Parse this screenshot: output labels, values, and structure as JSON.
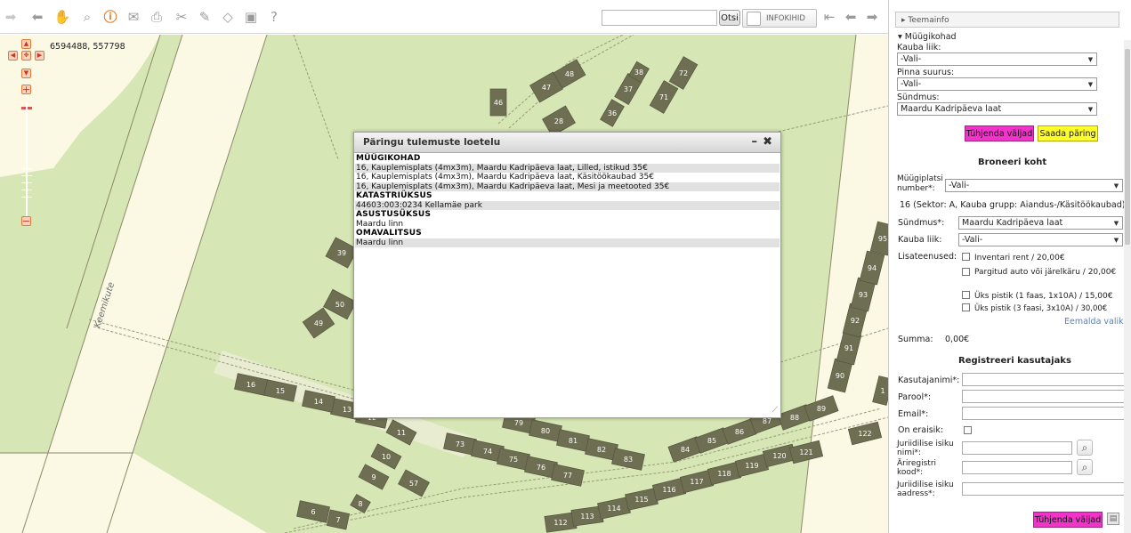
{
  "toolbar": {
    "help_label": "?",
    "search": {
      "value": "",
      "placeholder": ""
    },
    "search_button_label": "Otsi",
    "infokihid_label": "INFOKIHID"
  },
  "map": {
    "coordinates": "6594488, 557798",
    "street_label": "Keemikute",
    "parcels": [
      "6",
      "7",
      "8",
      "9",
      "10",
      "11",
      "12",
      "13",
      "14",
      "15",
      "16",
      "39",
      "46",
      "47",
      "48",
      "49",
      "50",
      "57",
      "72",
      "71",
      "37",
      "38",
      "36",
      "28",
      "73",
      "74",
      "75",
      "76",
      "77",
      "79",
      "80",
      "81",
      "82",
      "83",
      "84",
      "85",
      "86",
      "87",
      "88",
      "89",
      "90",
      "91",
      "92",
      "93",
      "94",
      "95",
      "1",
      "112",
      "113",
      "114",
      "115",
      "116",
      "117",
      "118",
      "119",
      "120",
      "121",
      "122"
    ]
  },
  "dialog": {
    "title": "Päringu tulemuste loetelu",
    "min_label": "–",
    "close_label": "✖",
    "sections": [
      {
        "heading": "MÜÜGIKOHAD",
        "rows": [
          "16, Kauplemisplats (4mx3m), Maardu Kadripäeva laat, Lilled, istikud 35€",
          "16, Kauplemisplats (4mx3m), Maardu Kadripäeva laat, Käsitöökaubad 35€",
          "16, Kauplemisplats (4mx3m), Maardu Kadripäeva laat, Mesi ja meetooted 35€"
        ]
      },
      {
        "heading": "KATASTRIÜKSUS",
        "rows": [
          "44603:003:0234 Kellamäe park"
        ]
      },
      {
        "heading": "ASUSTUSÜKSUS",
        "rows": [
          "Maardu linn"
        ]
      },
      {
        "heading": "OMAVALITSUS",
        "rows": [
          "Maardu linn"
        ]
      }
    ]
  },
  "panel": {
    "teemainfo": "Teemainfo",
    "myygikohad_label": "Müügikohad",
    "kauba_liik_label": "Kauba liik:",
    "kauba_liik_value": "-Vali-",
    "pinna_suurus_label": "Pinna suurus:",
    "pinna_suurus_value": "-Vali-",
    "syndmus_label": "Sündmus:",
    "syndmus_value": "Maardu Kadripäeva laat",
    "clear_label": "Tühjenda väljad",
    "send_label": "Saada päring",
    "broneeri_title": "Broneeri koht",
    "myygiplatsi_label": "Müügiplatsi number*:",
    "myygiplatsi_value": "-Vali-",
    "place_info": "16 (Sektor: A, Kauba grupp: Aiandus-/Käsitöökaubad)",
    "syndmus2_label": "Sündmus*:",
    "syndmus2_value": "Maardu Kadripäeva laat",
    "kauba_liik2_label": "Kauba liik:",
    "kauba_liik2_value": "-Vali-",
    "lisateenused_label": "Lisateenused:",
    "services": [
      "Inventari rent / 20,00€",
      "Pargitud auto või järelkäru / 20,00€",
      "Üks pistik (1 faas, 1x10A) / 15,00€",
      "Üks pistik (3 faasi, 3x10A) / 30,00€"
    ],
    "eemalda_label": "Eemalda valik",
    "summa_label": "Summa:",
    "summa_value": "0,00€",
    "register_title": "Registreeri kasutajaks",
    "kasutajanimi_label": "Kasutajanimi*:",
    "parool_label": "Parool*:",
    "email_label": "Email*:",
    "eraisik_label": "On eraisik:",
    "jur_nimi_label": "Juriidilise isiku nimi*:",
    "ariregistri_label": "Äriregistri kood*:",
    "jur_aadress_label": "Juriidilise isiku aadress*:",
    "clear2_label": "Tühjenda väljad"
  }
}
